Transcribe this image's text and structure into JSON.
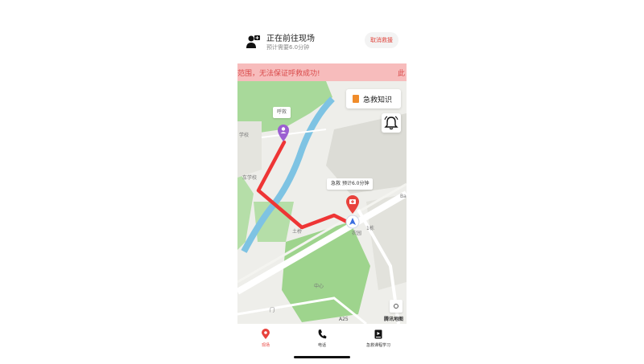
{
  "header": {
    "title": "正在前往现场",
    "subtitle": "预计需要6.0分钟",
    "cancel_label": "取消救援",
    "icon": "rescuer-person-icon"
  },
  "banner": {
    "text": "范围，无法保证呼救成功!",
    "tail": "此"
  },
  "map": {
    "first_aid_label": "急救知识",
    "caller_label": "呼救",
    "eta_label": "预计6.0分钟",
    "eta_prefix": "急救",
    "scale": "A25",
    "logo": "腾讯地图",
    "place_labels": [
      "学校",
      "车学校",
      "中心",
      "土桥",
      "门",
      "1栋",
      "Ba",
      "农园"
    ]
  },
  "tabs": [
    {
      "label": "现场",
      "icon": "location-pin-icon",
      "active": true
    },
    {
      "label": "电话",
      "icon": "phone-icon",
      "active": false
    },
    {
      "label": "急救课程学习",
      "icon": "book-video-icon",
      "active": false
    }
  ],
  "colors": {
    "accent": "#e8423c",
    "banner_bg": "#f7bcbc",
    "route": "#ee3535",
    "river": "#7ec3e3",
    "park": "#a8d99a",
    "caller_pin": "#9b5fd1"
  }
}
